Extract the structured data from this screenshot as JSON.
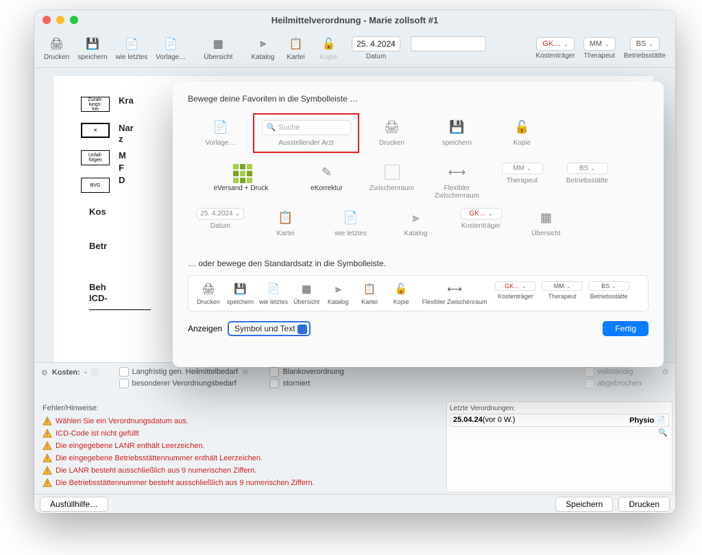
{
  "window": {
    "title": "Heilmittelverordnung -  Marie zollsoft #1"
  },
  "toolbar": {
    "items": [
      "Drucken",
      "speichern",
      "wie letztes",
      "Vorlage…",
      "Übersicht",
      "Katalog",
      "Kartei",
      "Kopie"
    ],
    "date_label": "Datum",
    "date_value": "25. 4.2024",
    "cost_label": "Kostenträger",
    "cost_value": "GK…",
    "therap_label": "Therapeut",
    "therap_value": "MM",
    "site_label": "Betriebsstätte",
    "site_value": "BS"
  },
  "doc": {
    "badges": [
      "Zuzah-\nlungs-\nfrei",
      "",
      "Unfall-\nfolgen",
      "BVG"
    ],
    "side": [
      "Kra",
      "Nar",
      "z",
      "M",
      "F",
      "D",
      "Kos",
      "Betr",
      "Beh",
      "ICD-"
    ]
  },
  "sheet": {
    "title": "Bewege deine Favoriten in die Symbolleiste …",
    "search_placeholder": "Suche",
    "favs": [
      "Vorlage…",
      "Ausstellender Arzt",
      "Drucken",
      "speichern",
      "Kopie",
      "eVersand + Druck",
      "eKorrektur",
      "Zwischenraum",
      "Flexibler Zwischenraum",
      "Therapeut",
      "Betriebsstätte",
      "Datum",
      "Kartei",
      "wie letztes",
      "Katalog",
      "Kostenträger",
      "Übersicht"
    ],
    "therap_pill": "MM",
    "site_pill": "BS",
    "date_pill": "25. 4.2024",
    "cost_pill": "GK…",
    "subtitle": "… oder bewege den Standardsatz in die Symbolleiste.",
    "defaults": [
      "Drucken",
      "speichern",
      "wie letztes",
      "Übersicht",
      "Katalog",
      "Kartei",
      "Kopie",
      "Flexibler Zwischenraum",
      "Kostenträger",
      "Therapeut",
      "Betriebsstätte"
    ],
    "def_cost": "GK…",
    "def_therap": "MM",
    "def_site": "BS",
    "anzeigen_label": "Anzeigen",
    "anzeigen_value": "Symbol und Text",
    "done": "Fertig"
  },
  "bottom": {
    "kosten_label": "Kosten:",
    "kosten_value": "-",
    "checks": {
      "langfristig": "Langfristig gen. Heilmittelbedarf",
      "besonderer": "besonderer Verordnungsbedarf",
      "blanko": "Blankoverordnung",
      "storniert": "storniert",
      "vollstaendig": "vollständig",
      "abgebrochen": "abgebrochen"
    },
    "errors_title": "Fehler/Hinweise:",
    "errors": [
      "Wählen Sie ein Verordnungsdatum aus.",
      "ICD-Code ist nicht gefüllt",
      "Die eingegebene LANR enthält Leerzeichen.",
      "Die eingegebene Betriebsstättennummer enthält Leerzeichen.",
      "Die LANR besteht ausschließlich aus 9 numerischen Ziffern.",
      "Die Betriebsstättennummer besteht ausschließlich aus 9 numerischen Ziffern."
    ],
    "recent_title": "Letzte Verordnungen:",
    "recent_date": "25.04.24",
    "recent_suffix": "(vor 0 W.)",
    "recent_type": "Physio"
  },
  "footer": {
    "help": "Ausfüllhilfe…",
    "save": "Speichern",
    "print": "Drucken"
  }
}
